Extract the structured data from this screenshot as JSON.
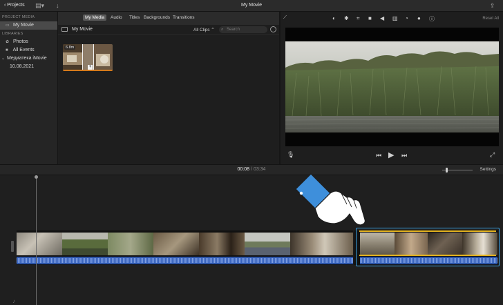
{
  "titlebar": {
    "back_label": "Projects",
    "title": "My Movie"
  },
  "tabs": {
    "my_media": "My Media",
    "audio": "Audio",
    "titles": "Titles",
    "backgrounds": "Backgrounds",
    "transitions": "Transitions"
  },
  "sidebar": {
    "project_media_header": "PROJECT MEDIA",
    "project_item": "My Movie",
    "libraries_header": "LIBRARIES",
    "items": [
      {
        "label": "Photos",
        "icon": "photos-icon"
      },
      {
        "label": "All Events",
        "icon": "events-icon"
      },
      {
        "label": "Медиатека iMovie",
        "icon": "chevron-down-icon"
      },
      {
        "label": "10.08.2021",
        "icon": ""
      }
    ]
  },
  "browser": {
    "project_name": "My Movie",
    "filter_label": "All Clips",
    "search_placeholder": "Search",
    "clip_duration": "6.8m"
  },
  "viewer": {
    "reset_label": "Reset All"
  },
  "timeline": {
    "current_time": "00:08",
    "separator": "/",
    "total_time": "03:34",
    "settings_label": "Settings"
  },
  "colors": {
    "selection_blue": "#3b9fe0",
    "trim_yellow": "#e3b21e",
    "audio_blue": "#2d55a8",
    "clip_orange": "#d57a1b",
    "hand_cuff": "#3e8fdb"
  }
}
